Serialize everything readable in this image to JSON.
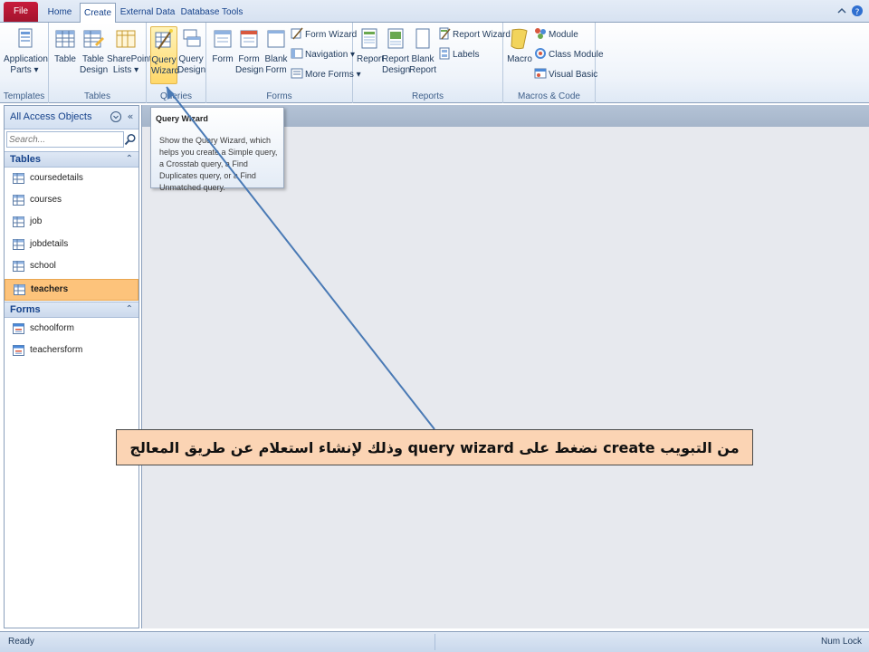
{
  "tabs": [
    {
      "label": "File"
    },
    {
      "label": "Home"
    },
    {
      "label": "Create"
    },
    {
      "label": "External Data"
    },
    {
      "label": "Database Tools"
    }
  ],
  "active_tab": "Create",
  "ribbon": {
    "templates": {
      "label": "Templates",
      "application_parts": "Application\nParts ▾"
    },
    "tables": {
      "label": "Tables",
      "table": "Table",
      "table_design": "Table\nDesign",
      "sharepoint_lists": "SharePoint\nLists ▾"
    },
    "queries": {
      "label": "Queries",
      "query_wizard": "Query\nWizard",
      "query_design": "Query\nDesign"
    },
    "forms": {
      "label": "Forms",
      "form": "Form",
      "form_design": "Form\nDesign",
      "blank_form": "Blank\nForm",
      "form_wizard": "Form Wizard",
      "navigation": "Navigation ▾",
      "more_forms": "More Forms ▾"
    },
    "reports": {
      "label": "Reports",
      "report": "Report",
      "report_design": "Report\nDesign",
      "blank_report": "Blank\nReport",
      "report_wizard": "Report Wizard",
      "labels": "Labels"
    },
    "macros": {
      "label": "Macros & Code",
      "macro": "Macro",
      "module": "Module",
      "class_module": "Class Module",
      "visual_basic": "Visual Basic"
    }
  },
  "nav": {
    "title": "All Access Objects",
    "search_placeholder": "Search...",
    "sections": [
      {
        "label": "Tables",
        "items": [
          {
            "label": "coursedetails",
            "selected": false
          },
          {
            "label": "courses",
            "selected": false
          },
          {
            "label": "job",
            "selected": false
          },
          {
            "label": "jobdetails",
            "selected": false
          },
          {
            "label": "school",
            "selected": false
          },
          {
            "label": "teachers",
            "selected": true
          }
        ]
      },
      {
        "label": "Forms",
        "items": [
          {
            "label": "schoolform",
            "selected": false
          },
          {
            "label": "teachersform",
            "selected": false
          }
        ]
      }
    ]
  },
  "tooltip": {
    "title": "Query Wizard",
    "body": "Show the Query Wizard, which helps you create a Simple query, a Crosstab query, a Find Duplicates query, or a Find Unmatched query."
  },
  "callout": {
    "text": "من التبويب create نضغط على query wizard وذلك لإنشاء استعلام عن طريق المعالج"
  },
  "status": {
    "left": "Ready",
    "right": "Num Lock"
  },
  "colors": {
    "file_tab": "#c81b3b",
    "selection": "#fdc37b",
    "callout_bg": "#fbd4b4",
    "arrow": "#4a7ab5"
  }
}
